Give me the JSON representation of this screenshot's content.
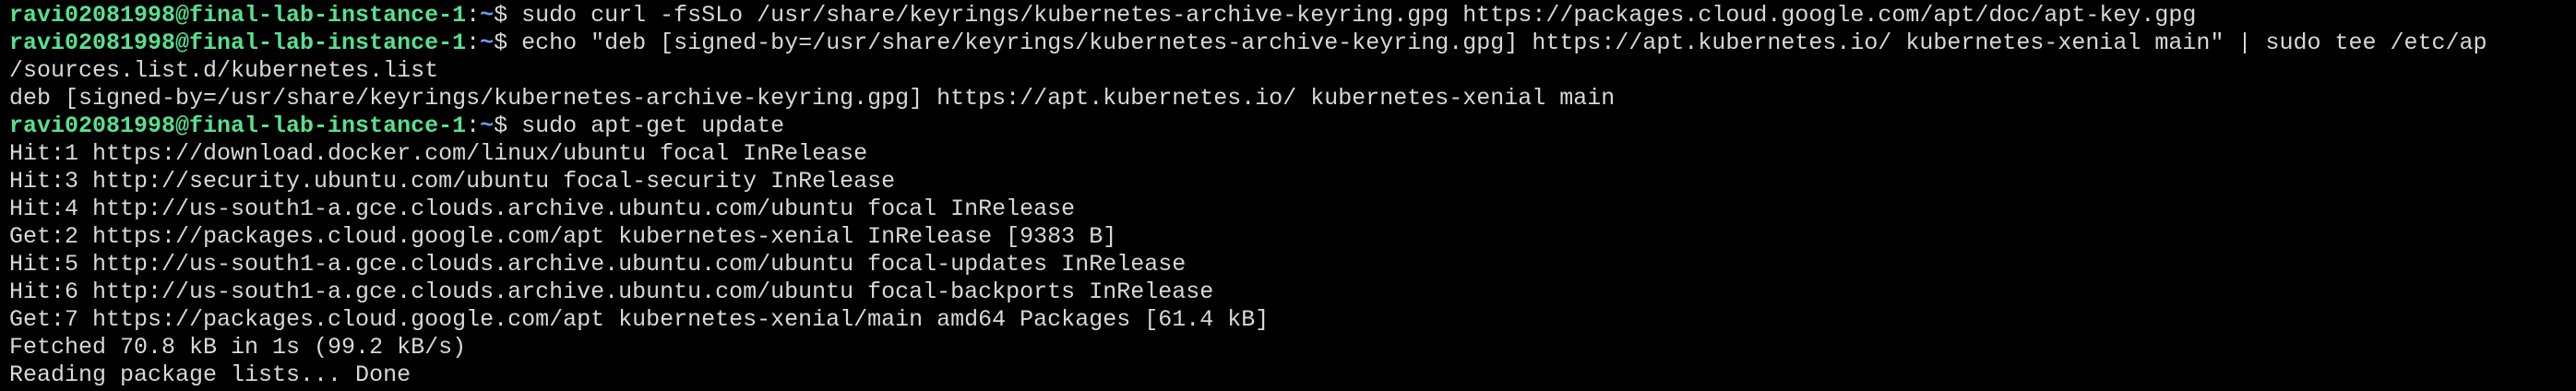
{
  "colors": {
    "background": "#000000",
    "text": "#d8d8d8",
    "prompt_user": "#58e08e",
    "prompt_path": "#6b9bef"
  },
  "lines": [
    {
      "type": "prompt",
      "user": "ravi02081998@final-lab-instance-1",
      "sep": ":",
      "path": "~",
      "dollar": "$ ",
      "command": "sudo curl -fsSLo /usr/share/keyrings/kubernetes-archive-keyring.gpg https://packages.cloud.google.com/apt/doc/apt-key.gpg"
    },
    {
      "type": "prompt",
      "user": "ravi02081998@final-lab-instance-1",
      "sep": ":",
      "path": "~",
      "dollar": "$ ",
      "command": "echo \"deb [signed-by=/usr/share/keyrings/kubernetes-archive-keyring.gpg] https://apt.kubernetes.io/ kubernetes-xenial main\" | sudo tee /etc/ap"
    },
    {
      "type": "output",
      "text": "/sources.list.d/kubernetes.list"
    },
    {
      "type": "output",
      "text": "deb [signed-by=/usr/share/keyrings/kubernetes-archive-keyring.gpg] https://apt.kubernetes.io/ kubernetes-xenial main"
    },
    {
      "type": "prompt",
      "user": "ravi02081998@final-lab-instance-1",
      "sep": ":",
      "path": "~",
      "dollar": "$ ",
      "command": "sudo apt-get update"
    },
    {
      "type": "output",
      "text": "Hit:1 https://download.docker.com/linux/ubuntu focal InRelease"
    },
    {
      "type": "output",
      "text": "Hit:3 http://security.ubuntu.com/ubuntu focal-security InRelease"
    },
    {
      "type": "output",
      "text": "Hit:4 http://us-south1-a.gce.clouds.archive.ubuntu.com/ubuntu focal InRelease"
    },
    {
      "type": "output",
      "text": "Get:2 https://packages.cloud.google.com/apt kubernetes-xenial InRelease [9383 B]"
    },
    {
      "type": "output",
      "text": "Hit:5 http://us-south1-a.gce.clouds.archive.ubuntu.com/ubuntu focal-updates InRelease"
    },
    {
      "type": "output",
      "text": "Hit:6 http://us-south1-a.gce.clouds.archive.ubuntu.com/ubuntu focal-backports InRelease"
    },
    {
      "type": "output",
      "text": "Get:7 https://packages.cloud.google.com/apt kubernetes-xenial/main amd64 Packages [61.4 kB]"
    },
    {
      "type": "output",
      "text": "Fetched 70.8 kB in 1s (99.2 kB/s)"
    },
    {
      "type": "output",
      "text": "Reading package lists... Done"
    }
  ]
}
